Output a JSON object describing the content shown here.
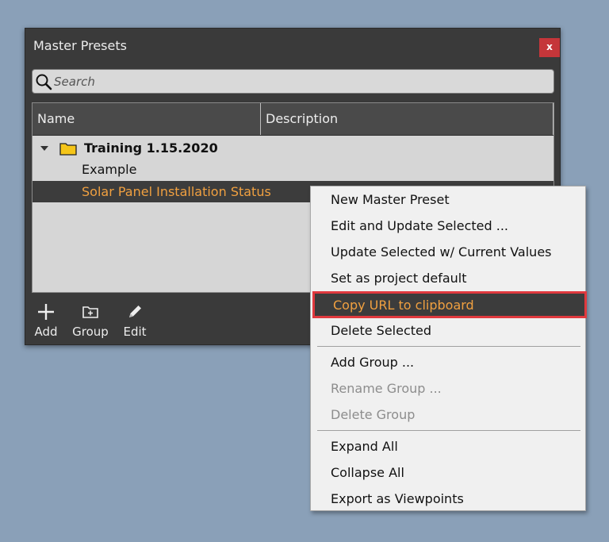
{
  "window": {
    "title": "Master Presets",
    "close_label": "x"
  },
  "search": {
    "placeholder": "Search",
    "value": ""
  },
  "tree": {
    "columns": [
      "Name",
      "Description"
    ],
    "groups": [
      {
        "label": "Training 1.15.2020",
        "expanded": true,
        "items": [
          {
            "label": "Example",
            "description": "",
            "selected": false
          },
          {
            "label": "Solar Panel Installation Status",
            "description": "",
            "selected": true
          }
        ]
      }
    ]
  },
  "toolbar": {
    "add_label": "Add",
    "group_label": "Group",
    "edit_label": "Edit"
  },
  "context_menu": {
    "items": [
      {
        "label": "New Master Preset",
        "enabled": true
      },
      {
        "label": "Edit and Update Selected ...",
        "enabled": true
      },
      {
        "label": "Update Selected w/ Current Values",
        "enabled": true
      },
      {
        "label": "Set as project default",
        "enabled": true
      },
      {
        "label": "Copy URL to clipboard",
        "enabled": true,
        "highlighted": true
      },
      {
        "label": "Delete Selected",
        "enabled": true
      },
      {
        "label": "Add Group ...",
        "enabled": true
      },
      {
        "label": "Rename Group ...",
        "enabled": false
      },
      {
        "label": "Delete Group",
        "enabled": false
      },
      {
        "label": "Expand All",
        "enabled": true
      },
      {
        "label": "Collapse All",
        "enabled": true
      },
      {
        "label": "Export as Viewpoints",
        "enabled": true
      }
    ]
  },
  "colors": {
    "background": "#8aa0b8",
    "panel": "#3a3a3a",
    "selection_text": "#f0a040",
    "close_button": "#c5363a",
    "highlight_border": "#e0393e",
    "folder": "#f5c518"
  }
}
